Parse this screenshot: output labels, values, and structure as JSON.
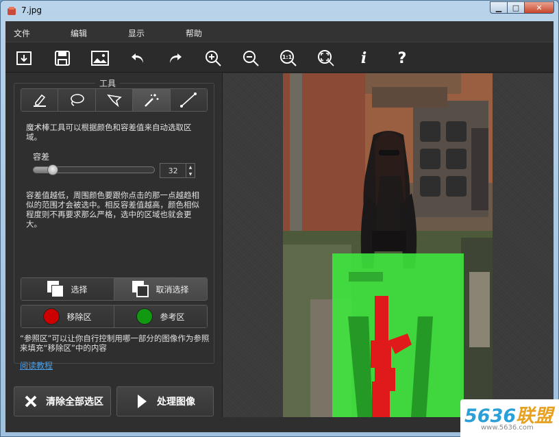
{
  "window": {
    "title": "7.jpg",
    "minimize": "▁",
    "maximize": "□",
    "close": "✕"
  },
  "menu": [
    "文件",
    "编辑",
    "显示",
    "帮助"
  ],
  "toolbar": [
    "open-icon",
    "save-icon",
    "image-icon",
    "undo-icon",
    "redo-icon",
    "zoom-in-icon",
    "zoom-out-icon",
    "actual-size-icon",
    "fit-icon",
    "info-icon",
    "help-icon"
  ],
  "toolbar_text": {
    "actual_size": "1:1",
    "info": "i",
    "help": "?"
  },
  "tools_panel": {
    "title": "工具",
    "tools": [
      "marker-icon",
      "lasso-icon",
      "polygon-lasso-icon",
      "magic-wand-icon",
      "line-icon"
    ],
    "active_tool": 3,
    "wand_description": "魔术棒工具可以根据颜色和容差值来自动选取区域。",
    "tolerance_label": "容差",
    "tolerance_value": "32",
    "tolerance_fraction": 0.16,
    "tolerance_help": "容差值越低，周围颜色要跟你点击的那一点越趋相似的范围才会被选中。相反容差值越高，颜色相似程度则不再要求那么严格，选中的区域也就会更大。",
    "select_label": "选择",
    "deselect_label": "取消选择",
    "remove_area_label": "移除区",
    "reference_area_label": "参考区",
    "remove_color": "#cc0000",
    "reference_color": "#119911",
    "reference_help": "“参照区”可以让你自行控制用哪一部分的图像作为参照来填充“移除区”中的内容",
    "tutorial_link": "阅读教程"
  },
  "actions": {
    "clear_label": "清除全部选区",
    "process_label": "处理图像"
  },
  "watermark": {
    "digits": "5636",
    "cn": "联盟",
    "url": "www.5636.com"
  }
}
